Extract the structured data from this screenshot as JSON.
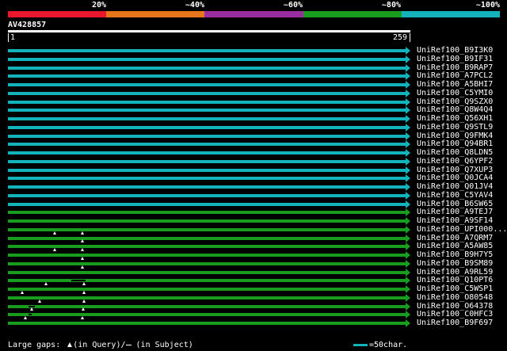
{
  "percent_labels": [
    "20%",
    "~40%",
    "~60%",
    "~80%",
    "~100%"
  ],
  "color_bands": [
    "#e8172d",
    "#e7761a",
    "#9a2ea1",
    "#199d1f",
    "#14b3bb"
  ],
  "query": {
    "name": "AV428857",
    "start": "1",
    "end": "259"
  },
  "hits": [
    {
      "name": "UniRef100_B9I3K0",
      "color": "#14b3bb"
    },
    {
      "name": "UniRef100_B9IF31",
      "color": "#14b3bb"
    },
    {
      "name": "UniRef100_B9RAP7",
      "color": "#14b3bb"
    },
    {
      "name": "UniRef100_A7PCL2",
      "color": "#14b3bb"
    },
    {
      "name": "UniRef100_A5BHI7",
      "color": "#14b3bb"
    },
    {
      "name": "UniRef100_C5YMI0",
      "color": "#14b3bb"
    },
    {
      "name": "UniRef100_Q9SZX0",
      "color": "#14b3bb"
    },
    {
      "name": "UniRef100_Q8W4Q4",
      "color": "#14b3bb"
    },
    {
      "name": "UniRef100_Q56XH1",
      "color": "#14b3bb"
    },
    {
      "name": "UniRef100_Q9STL9",
      "color": "#14b3bb"
    },
    {
      "name": "UniRef100_Q9FMK4",
      "color": "#14b3bb"
    },
    {
      "name": "UniRef100_Q94BR1",
      "color": "#14b3bb"
    },
    {
      "name": "UniRef100_Q8LDN5",
      "color": "#14b3bb"
    },
    {
      "name": "UniRef100_Q6YPF2",
      "color": "#14b3bb"
    },
    {
      "name": "UniRef100_Q7XUP3",
      "color": "#14b3bb"
    },
    {
      "name": "UniRef100_Q0JCA4",
      "color": "#14b3bb"
    },
    {
      "name": "UniRef100_Q01JV4",
      "color": "#14b3bb"
    },
    {
      "name": "UniRef100_C5YAV4",
      "color": "#14b3bb"
    },
    {
      "name": "UniRef100_B6SW65",
      "color": "#14b3bb"
    },
    {
      "name": "UniRef100_A9TEJ7",
      "color": "#199d1f"
    },
    {
      "name": "UniRef100_A9SF14",
      "color": "#199d1f"
    },
    {
      "name": "UniRef100_UPI000...",
      "color": "#199d1f"
    },
    {
      "name": "UniRef100_A7QRM7",
      "color": "#199d1f"
    },
    {
      "name": "UniRef100_A5AW85",
      "color": "#199d1f"
    },
    {
      "name": "UniRef100_B9H7Y5",
      "color": "#199d1f"
    },
    {
      "name": "UniRef100_B9SM89",
      "color": "#199d1f"
    },
    {
      "name": "UniRef100_A9RL59",
      "color": "#199d1f"
    },
    {
      "name": "UniRef100_Q10PT6",
      "color": "#199d1f"
    },
    {
      "name": "UniRef100_C5WSP1",
      "color": "#199d1f"
    },
    {
      "name": "UniRef100_O80548",
      "color": "#199d1f"
    },
    {
      "name": "UniRef100_O64378",
      "color": "#199d1f"
    },
    {
      "name": "UniRef100_C0HFC3",
      "color": "#199d1f"
    },
    {
      "name": "UniRef100_B9F697",
      "color": "#199d1f"
    }
  ],
  "footer": {
    "gaps_text": "Large gaps:",
    "query_gap_text": "(in Query)/",
    "subject_gap_text": "(in Subject)",
    "legend_text": "=50char.",
    "legend_color": "#14b3bb"
  }
}
